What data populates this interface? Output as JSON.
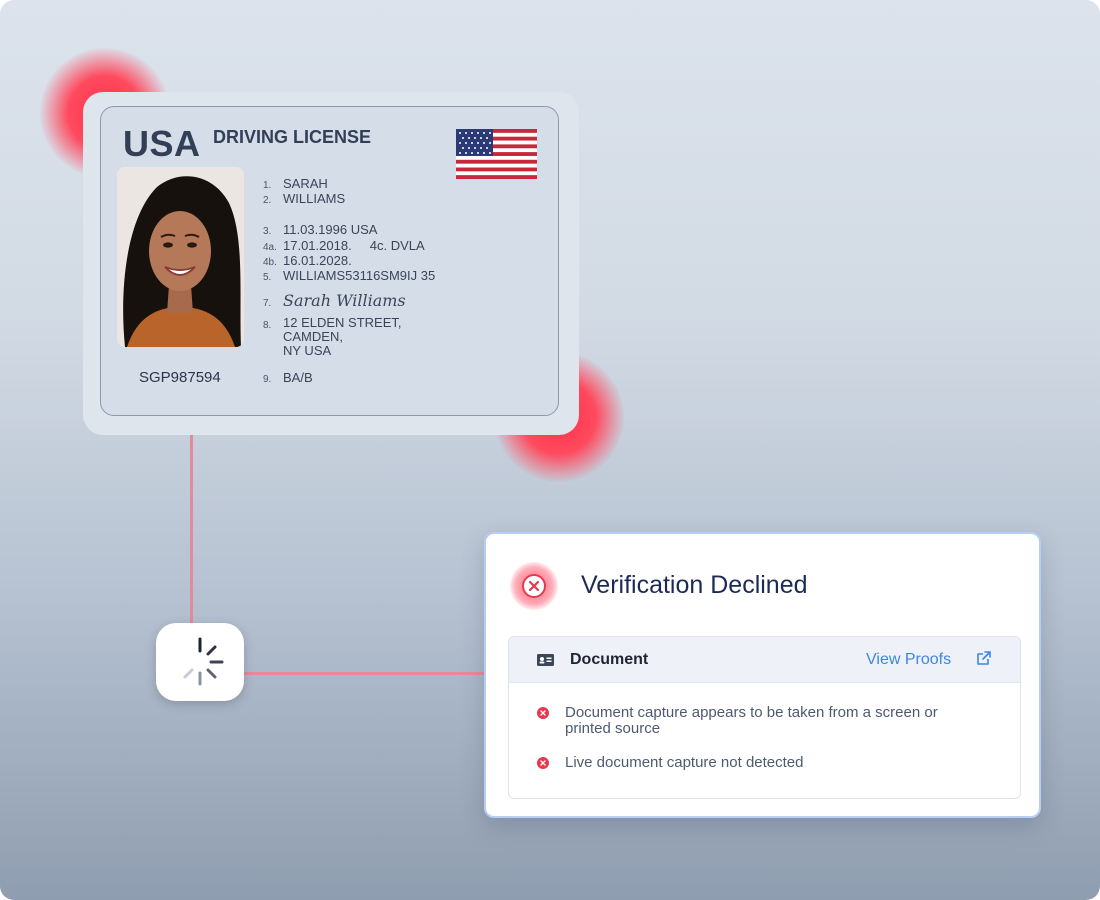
{
  "license": {
    "country": "USA",
    "type": "DRIVING LICENSE",
    "doc_number": "SGP987594",
    "fields": [
      {
        "num": "1.",
        "value": "SARAH"
      },
      {
        "num": "2.",
        "value": "WILLIAMS"
      },
      {
        "num": "3.",
        "value": "11.03.1996 USA"
      },
      {
        "num": "4a.",
        "value": "17.01.2018.     4c. DVLA"
      },
      {
        "num": "4b.",
        "value": "16.01.2028."
      },
      {
        "num": "5.",
        "value": "WILLIAMS53116SM9IJ 35"
      },
      {
        "num": "7.",
        "value": "Sarah Williams"
      },
      {
        "num": "8.",
        "value": "12 ELDEN STREET,\nCAMDEN,\nNY USA"
      },
      {
        "num": "9.",
        "value": "BA/B"
      }
    ]
  },
  "verification": {
    "title": "Verification Declined",
    "section_label": "Document",
    "view_proofs": "View Proofs",
    "reasons": [
      "Document capture appears to be taken from a screen or\nprinted source",
      "Live document capture not detected"
    ]
  },
  "colors": {
    "decline_red": "#e43a50",
    "link_blue": "#3c86e6",
    "connector_pink": "#e58a9a",
    "title_navy": "#1e2a55"
  },
  "icons": [
    "us-flag-icon",
    "loading-spinner-icon",
    "decline-x-icon",
    "id-card-icon",
    "external-link-icon",
    "error-dot-icon"
  ]
}
